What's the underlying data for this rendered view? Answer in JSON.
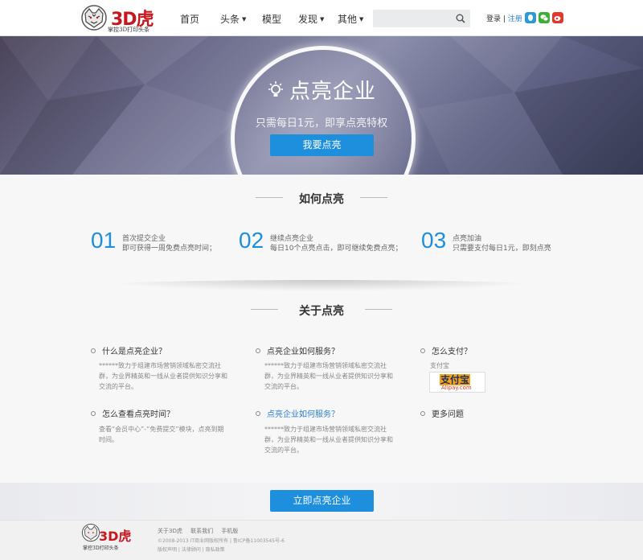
{
  "header": {
    "logo_brand": "3D虎",
    "logo_slogan": "掌控3D打印头条",
    "nav": [
      {
        "label": "首页",
        "has_dropdown": false
      },
      {
        "label": "头条",
        "has_dropdown": true
      },
      {
        "label": "模型",
        "has_dropdown": false
      },
      {
        "label": "发现",
        "has_dropdown": true
      },
      {
        "label": "其他",
        "has_dropdown": true
      }
    ],
    "search_placeholder": "",
    "login": "登录",
    "separator": "|",
    "register": "注册",
    "social_icons": [
      "qq-icon",
      "wechat-icon",
      "weibo-icon"
    ]
  },
  "hero": {
    "title": "点亮企业",
    "subtitle": "只需每日1元，即享点亮特权",
    "button": "我要点亮"
  },
  "how": {
    "title": "如何点亮",
    "steps": [
      {
        "num": "01",
        "title": "首次提交企业",
        "desc": "即可获得一周免费点亮时间；"
      },
      {
        "num": "02",
        "title": "继续点亮企业",
        "desc": "每日10个点亮点击，即可继续免费点亮；"
      },
      {
        "num": "03",
        "title": "点亮加油",
        "desc": "只需要支付每日1元，即刻点亮"
      }
    ]
  },
  "about": {
    "title": "关于点亮",
    "items": [
      {
        "q": "什么是点亮企业？",
        "a": "******致力于组建市场营销领域私密交流社群，为业界精英和一线从业者提供知识分享和交流的平台。",
        "highlight": false
      },
      {
        "q": "点亮企业如何服务？",
        "a": "******致力于组建市场营销领域私密交流社群，为业界精英和一线从业者提供知识分享和交流的平台。",
        "highlight": false
      },
      {
        "q": "怎么支付？",
        "a": "",
        "highlight": false
      },
      {
        "q": "怎么查看点亮时间？",
        "a": "查看“会员中心”-“免费提交”模块，点亮到期时间。",
        "highlight": false
      },
      {
        "q": "点亮企业如何服务？",
        "a": "******致力于组建市场营销领域私密交流社群，为业界精英和一线从业者提供知识分享和交流的平台。",
        "highlight": true
      },
      {
        "q": "更多问题",
        "a": "",
        "highlight": false
      }
    ],
    "pay_label": "支付宝",
    "alipay_main": "支付宝",
    "alipay_sub": "Alipay.com"
  },
  "cta": {
    "button": "立即点亮企业"
  },
  "footer": {
    "logo_brand": "3D虎",
    "logo_slogan": "掌控3D打印头条",
    "links": [
      "关于3D虎",
      "联系我们",
      "手机版"
    ],
    "copyright": "©2008-2013 IT商业网版权所有 | 鲁ICP备11003545号-6",
    "policy": "版权声明 | 法律顾问 | 隐私政策"
  },
  "colors": {
    "accent": "#1d8fdc",
    "brand": "#c8161d",
    "link": "#2a7fd0"
  }
}
